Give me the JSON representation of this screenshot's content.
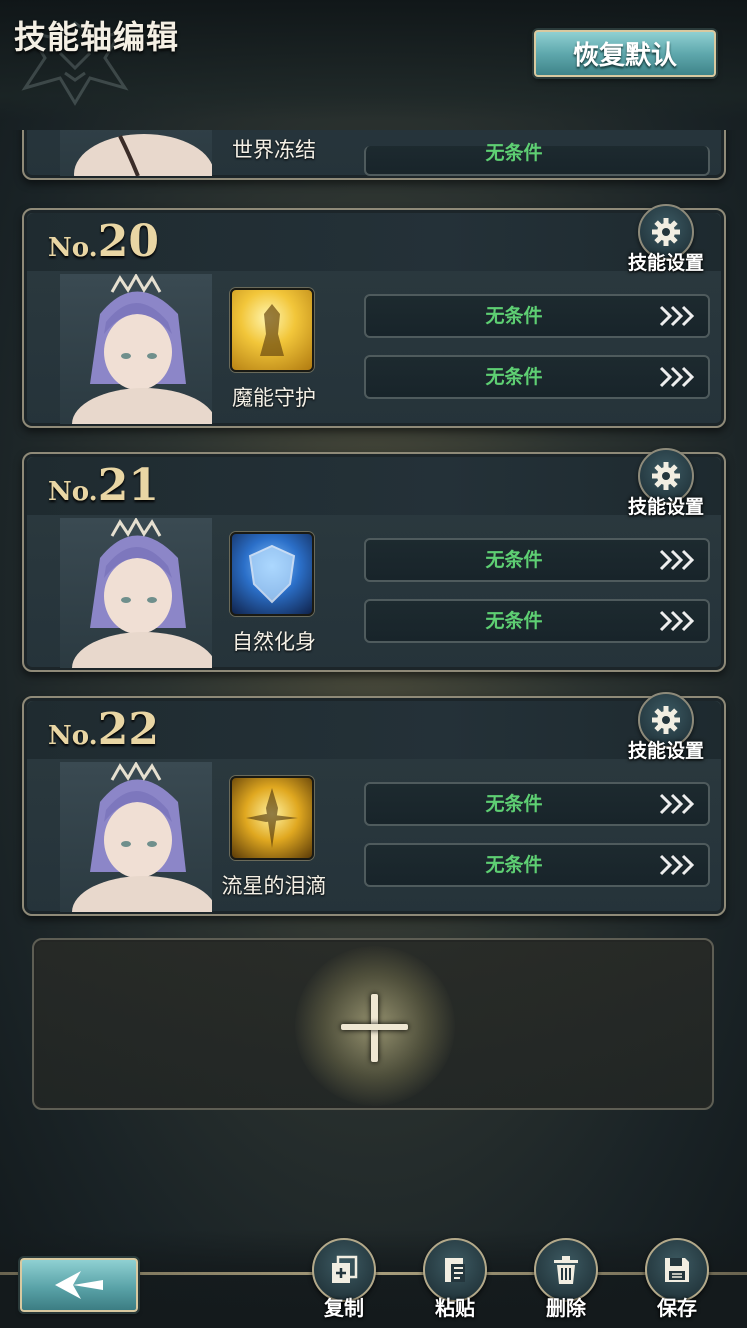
{
  "header": {
    "title": "技能轴编辑",
    "reset_label": "恢复默认"
  },
  "partial_card": {
    "skill_name": "世界冻结",
    "condition": "无条件"
  },
  "cards": [
    {
      "no_prefix": "No.",
      "number": "20",
      "settings_label": "技能设置",
      "skill_name": "魔能守护",
      "skill_icon": "golden-warrior-icon",
      "conditions": [
        "无条件",
        "无条件"
      ]
    },
    {
      "no_prefix": "No.",
      "number": "21",
      "settings_label": "技能设置",
      "skill_name": "自然化身",
      "skill_icon": "blue-shield-icon",
      "conditions": [
        "无条件",
        "无条件"
      ]
    },
    {
      "no_prefix": "No.",
      "number": "22",
      "settings_label": "技能设置",
      "skill_name": "流星的泪滴",
      "skill_icon": "golden-burst-icon",
      "conditions": [
        "无条件",
        "无条件"
      ]
    }
  ],
  "toolbar": {
    "copy_label": "复制",
    "paste_label": "粘贴",
    "delete_label": "删除",
    "save_label": "保存"
  },
  "colors": {
    "accent_teal": "#5fa8ad",
    "condition_green": "#5ecf73",
    "gold_text": "#e9d6a4",
    "frame": "#8f8a78"
  }
}
